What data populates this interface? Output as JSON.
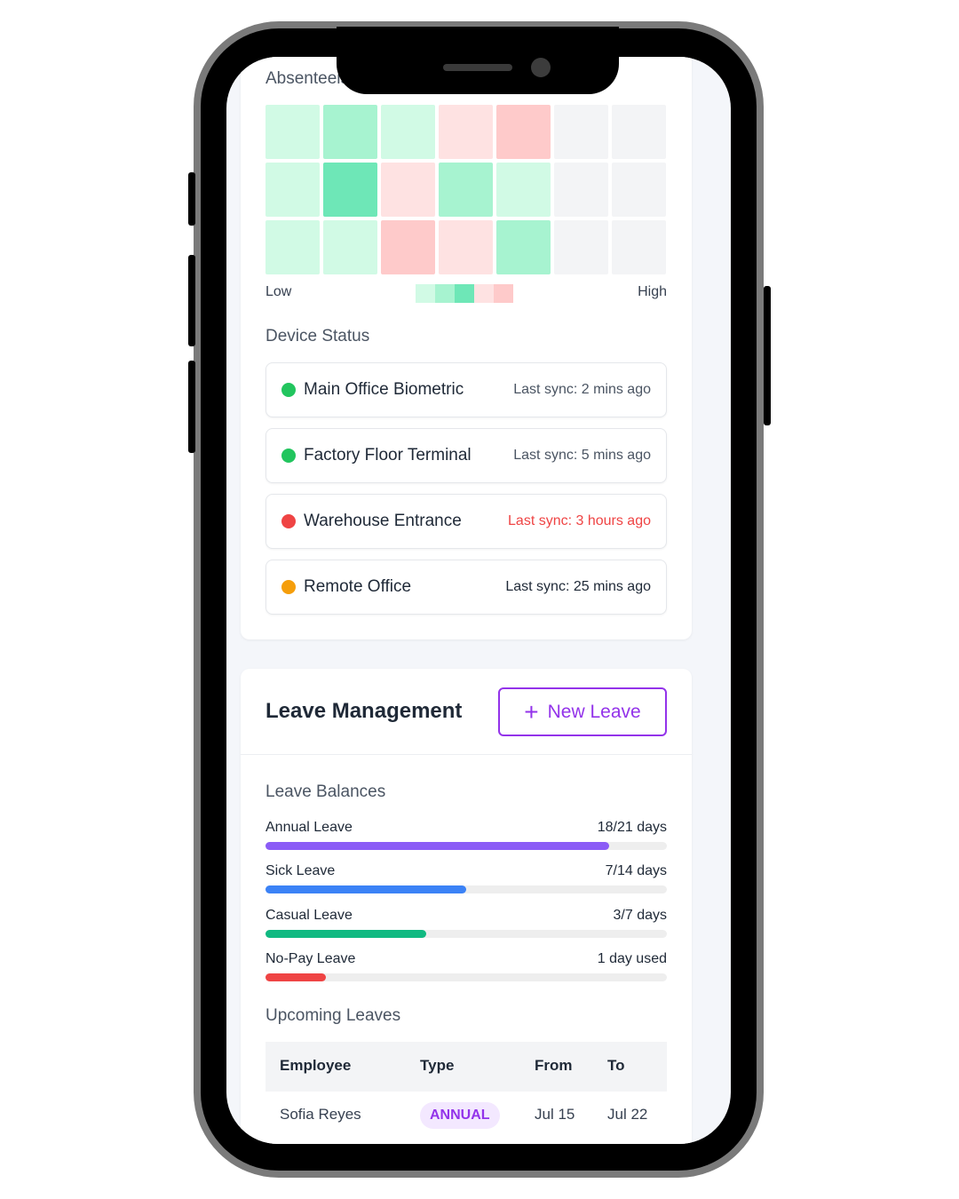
{
  "heatmap": {
    "title": "Absenteeism",
    "cells": [
      [
        "#d1fae5",
        "#a7f3d0",
        "#d1fae5",
        "#fee2e2",
        "#fecaca",
        "#f3f4f6",
        "#f3f4f6"
      ],
      [
        "#d1fae5",
        "#6ee7b7",
        "#fee2e2",
        "#a7f3d0",
        "#d1fae5",
        "#f3f4f6",
        "#f3f4f6"
      ],
      [
        "#d1fae5",
        "#d1fae5",
        "#fecaca",
        "#fee2e2",
        "#a7f3d0",
        "#f3f4f6",
        "#f3f4f6"
      ]
    ],
    "legend_low": "Low",
    "legend_high": "High",
    "legend_colors": [
      "#d1fae5",
      "#a7f3d0",
      "#6ee7b7",
      "#fee2e2",
      "#fecaca"
    ]
  },
  "device_status": {
    "title": "Device Status",
    "devices": [
      {
        "name": "Main Office Biometric",
        "sync": "Last sync: 2 mins ago",
        "status_color": "#22c55e",
        "sync_color": "#4b5563"
      },
      {
        "name": "Factory Floor Terminal",
        "sync": "Last sync: 5 mins ago",
        "status_color": "#22c55e",
        "sync_color": "#4b5563"
      },
      {
        "name": "Warehouse Entrance",
        "sync": "Last sync: 3 hours ago",
        "status_color": "#ef4444",
        "sync_color": "#ef4444"
      },
      {
        "name": "Remote Office",
        "sync": "Last sync: 25 mins ago",
        "status_color": "#f59e0b",
        "sync_color": "#1f2937"
      }
    ]
  },
  "leave_management": {
    "title": "Leave Management",
    "new_leave_label": "New Leave",
    "balances_title": "Leave Balances",
    "balances": [
      {
        "label": "Annual Leave",
        "value": "18/21 days",
        "fraction": 0.857,
        "color": "#8b5cf6"
      },
      {
        "label": "Sick Leave",
        "value": "7/14 days",
        "fraction": 0.5,
        "color": "#3b82f6"
      },
      {
        "label": "Casual Leave",
        "value": "3/7 days",
        "fraction": 0.4,
        "color": "#10b981"
      },
      {
        "label": "No-Pay Leave",
        "value": "1 day used",
        "fraction": 0.15,
        "color": "#ef4444"
      }
    ],
    "upcoming_title": "Upcoming Leaves",
    "table": {
      "headers": [
        "Employee",
        "Type",
        "From",
        "To"
      ],
      "rows": [
        {
          "employee": "Sofia Reyes",
          "type": "ANNUAL",
          "from": "Jul 15",
          "to": "Jul 22"
        }
      ]
    }
  }
}
